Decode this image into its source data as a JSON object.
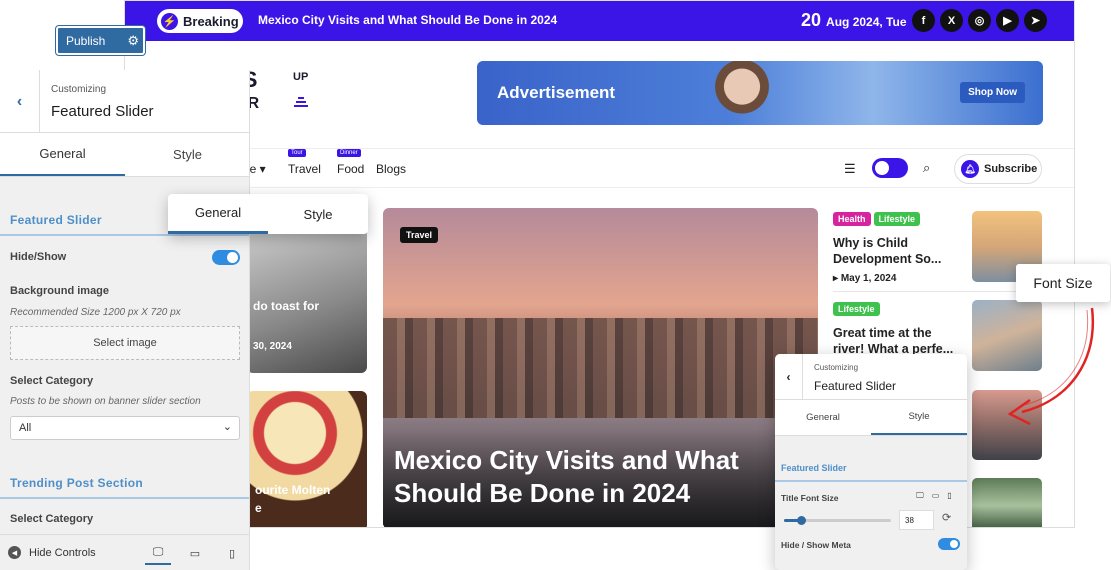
{
  "topbar": {
    "breaking_label": "Breaking",
    "ticker_text": "Mexico City Visits and What Should Be Done in 2024",
    "date_day": "20",
    "date_rest": "Aug 2024, Tue",
    "socials": [
      "facebook-icon",
      "x-icon",
      "instagram-icon",
      "youtube-icon",
      "telegram-icon"
    ]
  },
  "logo": {
    "line1": "WS",
    "line2": "ER",
    "sup": "UP"
  },
  "ad": {
    "label": "Advertisement",
    "cta": "Shop Now"
  },
  "nav": {
    "items": [
      {
        "label": "le ▾",
        "tag": ""
      },
      {
        "label": "Travel",
        "tag": "Tour"
      },
      {
        "label": "Food",
        "tag": "Dinner"
      },
      {
        "label": "Blogs",
        "tag": ""
      }
    ],
    "subscribe_label": "Subscribe"
  },
  "left_cards": {
    "card1_title": "do toast for",
    "card1_date": "30, 2024",
    "card2_line1": "ourite Molten",
    "card2_line2": "e"
  },
  "hero": {
    "category": "Travel",
    "title": "Mexico City Visits and What Should Be Done in 2024"
  },
  "side_posts": [
    {
      "chips": [
        "Health",
        "Lifestyle"
      ],
      "title": "Why is Child Development So...",
      "date": "May 1, 2024"
    },
    {
      "chips": [
        "Lifestyle"
      ],
      "title": "Great time at the river! What a perfe..."
    }
  ],
  "colors": {
    "brand": "#3b14e8",
    "accent": "#2f6aa1",
    "chip_health": "#d6249f",
    "chip_lifestyle": "#3ec24d"
  },
  "customizer": {
    "publish_label": "Publish",
    "customizing_label": "Customizing",
    "panel_title": "Featured Slider",
    "tab_general": "General",
    "tab_style": "Style",
    "section_featured": "Featured Slider",
    "hide_show_label": "Hide/Show",
    "bg_image_label": "Background image",
    "bg_image_desc": "Recommended Size 1200 px X 720 px",
    "select_image_label": "Select image",
    "select_category_label": "Select Category",
    "select_category_desc": "Posts to be shown on banner slider section",
    "category_value": "All",
    "section_trending": "Trending Post Section",
    "select_category_label2": "Select Category",
    "hide_controls_label": "Hide Controls"
  },
  "float_tabs": {
    "general": "General",
    "style": "Style"
  },
  "mini": {
    "customizing_label": "Customizing",
    "title": "Featured Slider",
    "tab_general": "General",
    "tab_style": "Style",
    "section": "Featured Slider",
    "title_font_size_label": "Title Font Size",
    "font_size_value": "38",
    "slider_fraction": 0.16,
    "hide_show_meta_label": "Hide / Show Meta"
  },
  "callout_label": "Font Size"
}
